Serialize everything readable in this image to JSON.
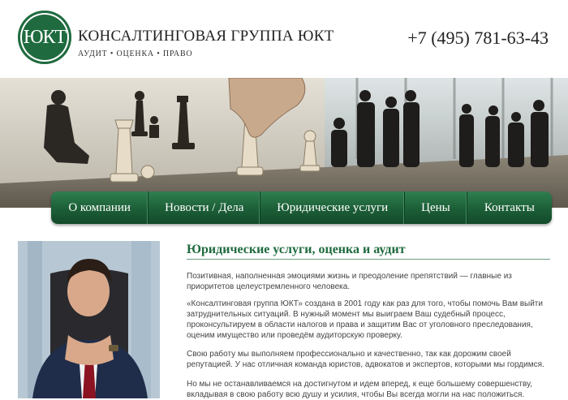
{
  "header": {
    "logo_text": "ЮКТ",
    "company_name": "КОНСАЛТИНГОВАЯ ГРУППА ЮКТ",
    "tagline": "АУДИТ • ОЦЕНКА • ПРАВО",
    "phone": "+7 (495) 781-63-43"
  },
  "nav": {
    "items": [
      {
        "label": "О компании"
      },
      {
        "label": "Новости / Дела"
      },
      {
        "label": "Юридические услуги"
      },
      {
        "label": "Цены"
      },
      {
        "label": "Контакты"
      }
    ]
  },
  "main": {
    "title": "Юридические услуги, оценка и аудит",
    "paragraphs": [
      "Позитивная, наполненная эмоциями жизнь и преодоление препятствий — главные из приоритетов целеустремленного человека.",
      "«Консалтинговая группа ЮКТ» создана в 2001 году как раз для того, чтобы помочь Вам выйти затруднительных ситуаций. В нужный момент мы выиграем Ваш судебный процесс, проконсультируем в области налогов и права и защитим Вас от уголовного преследования, оценим имущество или проведём аудиторскую проверку.",
      "Свою работу мы выполняем профессионально и качественно, так как дорожим своей репутацией. У нас отличная команда юристов, адвокатов и экспертов, которыми мы гордимся.",
      "Но мы не останавливаемся на достигнутом и идем вперед, к еще большему совершенству, вкладывая в свою работу всю душу и усилия, чтобы Вы всегда могли на нас положиться."
    ]
  },
  "colors": {
    "brand_green": "#1f6b3f",
    "nav_green": "#1c5e37",
    "text": "#444444"
  },
  "icons": {
    "logo": "ukt-logo-icon",
    "banner": "chess-banner-image",
    "portrait": "lawyer-portrait-image"
  }
}
